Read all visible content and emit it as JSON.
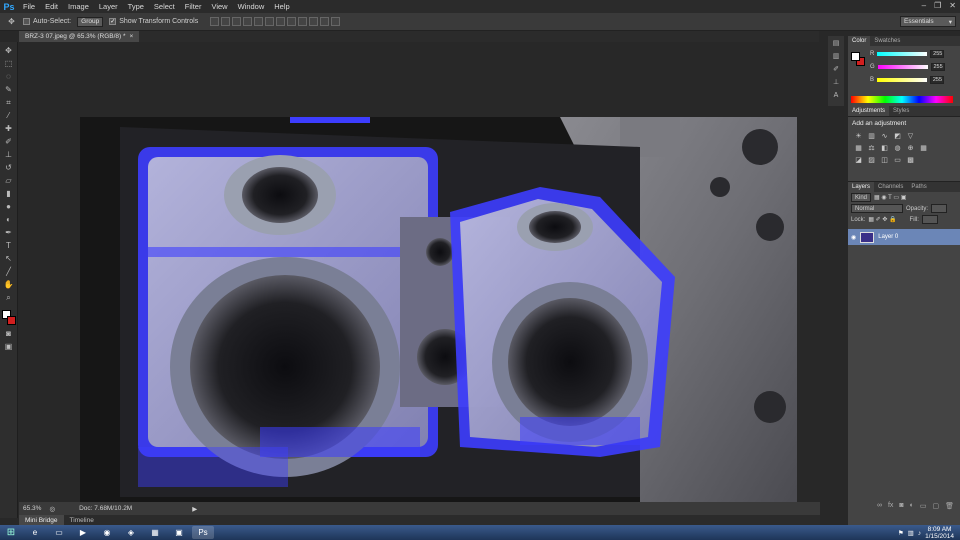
{
  "app": {
    "logo": "Ps",
    "window_controls": [
      "–",
      "❐",
      "✕"
    ]
  },
  "menu": [
    "File",
    "Edit",
    "Image",
    "Layer",
    "Type",
    "Select",
    "Filter",
    "View",
    "Window",
    "Help"
  ],
  "options": {
    "auto_select_label": "Auto-Select:",
    "auto_select_value": "Group",
    "show_transform_label": "Show Transform Controls",
    "workspace": "Essentials"
  },
  "document": {
    "tab_title": "BRZ-3 07.jpeg @ 65.3% (RGB/8) *",
    "close": "×"
  },
  "status": {
    "zoom": "65.3%",
    "doc_info": "Doc: 7.68M/10.2M"
  },
  "bottom_tabs": [
    "Mini Bridge",
    "Timeline"
  ],
  "color_panel": {
    "tabs": [
      "Color",
      "Swatches"
    ],
    "channels": [
      {
        "label": "R",
        "value": "255"
      },
      {
        "label": "G",
        "value": "255"
      },
      {
        "label": "B",
        "value": "255"
      }
    ]
  },
  "adjustments": {
    "tabs": [
      "Adjustments",
      "Styles"
    ],
    "title": "Add an adjustment"
  },
  "layers": {
    "tabs": [
      "Layers",
      "Channels",
      "Paths"
    ],
    "kind": "Kind",
    "blend": "Normal",
    "opacity_label": "Opacity:",
    "lock_label": "Lock:",
    "fill_label": "Fill:",
    "layer_name": "Layer 0"
  },
  "taskbar": {
    "time": "8:09 AM",
    "date": "1/15/2014"
  },
  "colors": {
    "accent": "#31a8ff",
    "bg_color": "#d11f1f",
    "selection_blue": "#3d3dff"
  },
  "icons": [
    "move-tool-icon",
    "marquee-tool-icon",
    "lasso-tool-icon",
    "quick-select-icon",
    "crop-tool-icon",
    "eyedropper-icon",
    "healing-brush-icon",
    "brush-tool-icon",
    "clone-stamp-icon",
    "history-brush-icon",
    "eraser-icon",
    "gradient-icon",
    "blur-icon",
    "dodge-icon",
    "pen-tool-icon",
    "type-tool-icon",
    "path-select-icon",
    "shape-tool-icon",
    "hand-tool-icon",
    "zoom-tool-icon"
  ]
}
